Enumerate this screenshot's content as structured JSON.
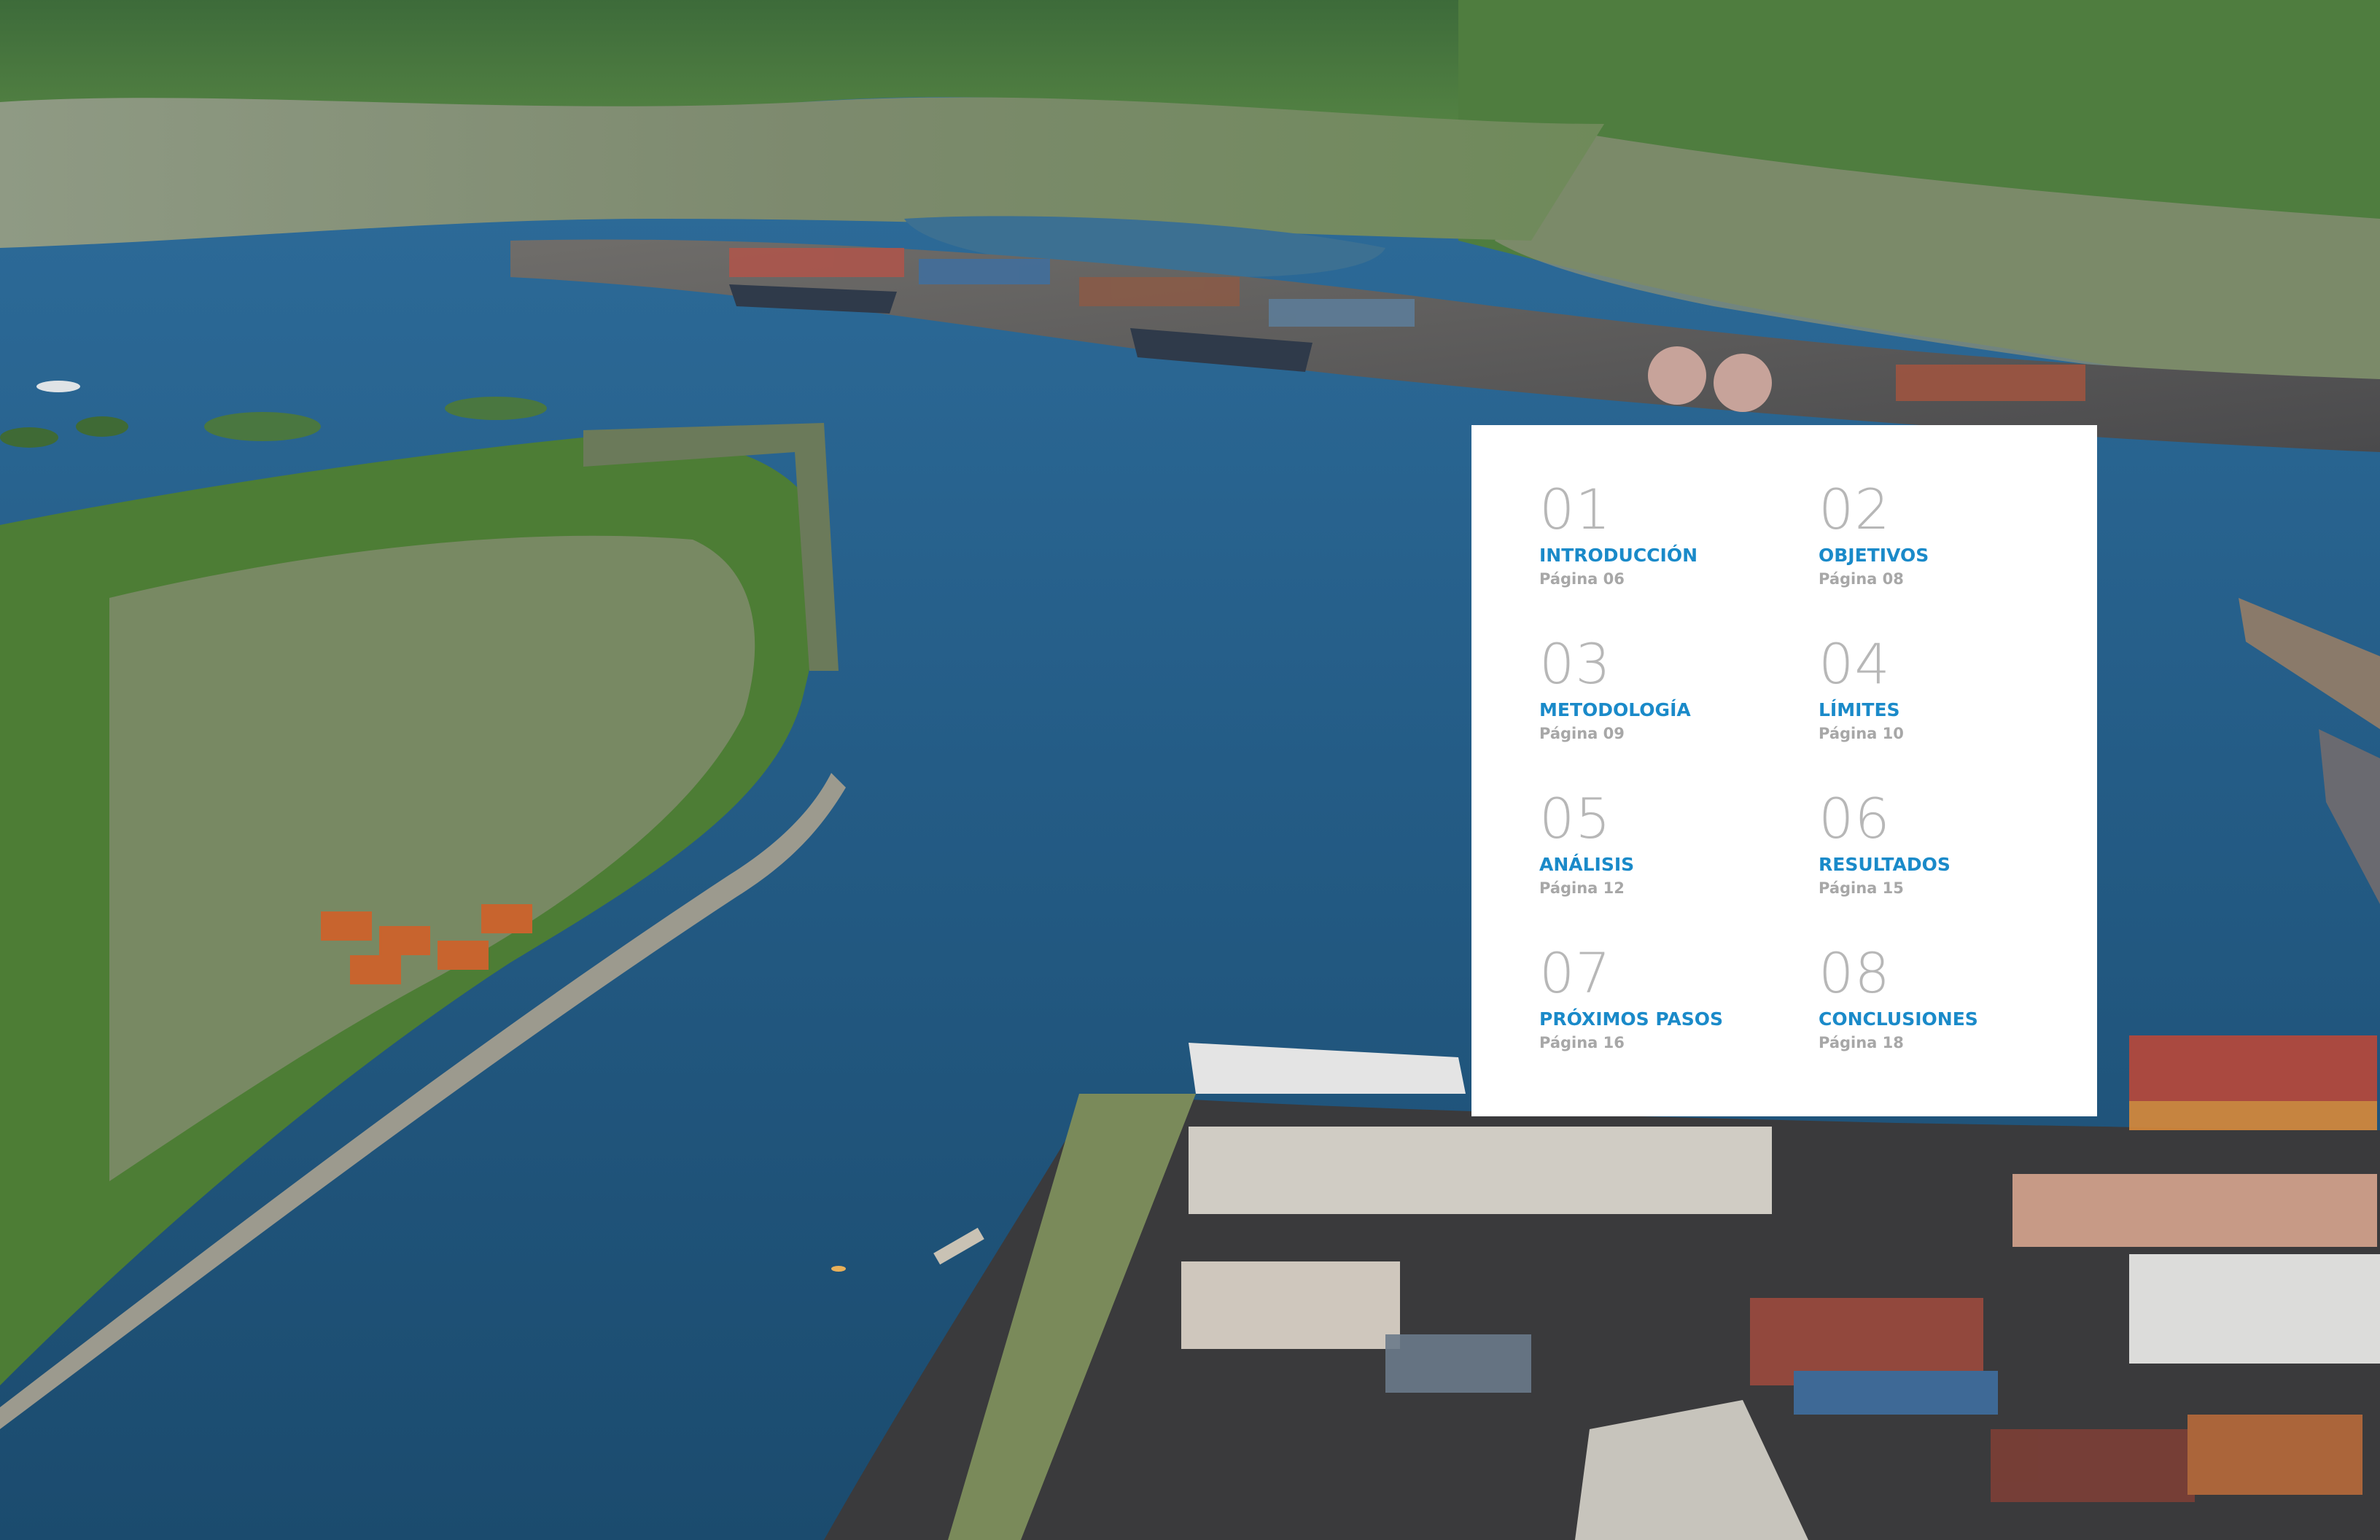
{
  "toc": {
    "entries": [
      {
        "number": "01",
        "title": "INTRODUCCIÓN",
        "page": "Página 06"
      },
      {
        "number": "02",
        "title": "OBJETIVOS",
        "page": "Página 08"
      },
      {
        "number": "03",
        "title": "METODOLOGÍA",
        "page": "Página 09"
      },
      {
        "number": "04",
        "title": "LÍMITES",
        "page": "Página 10"
      },
      {
        "number": "05",
        "title": "ANÁLISIS",
        "page": "Página 12"
      },
      {
        "number": "06",
        "title": "RESULTADOS",
        "page": "Página 15"
      },
      {
        "number": "07",
        "title": "PRÓXIMOS PASOS",
        "page": "Página 16"
      },
      {
        "number": "08",
        "title": "CONCLUSIONES",
        "page": "Página 18"
      }
    ]
  },
  "colors": {
    "accent": "#1a8ac9",
    "number_gray": "#b7b7b7",
    "page_gray": "#a7a7a7",
    "card": "#ffffff"
  }
}
